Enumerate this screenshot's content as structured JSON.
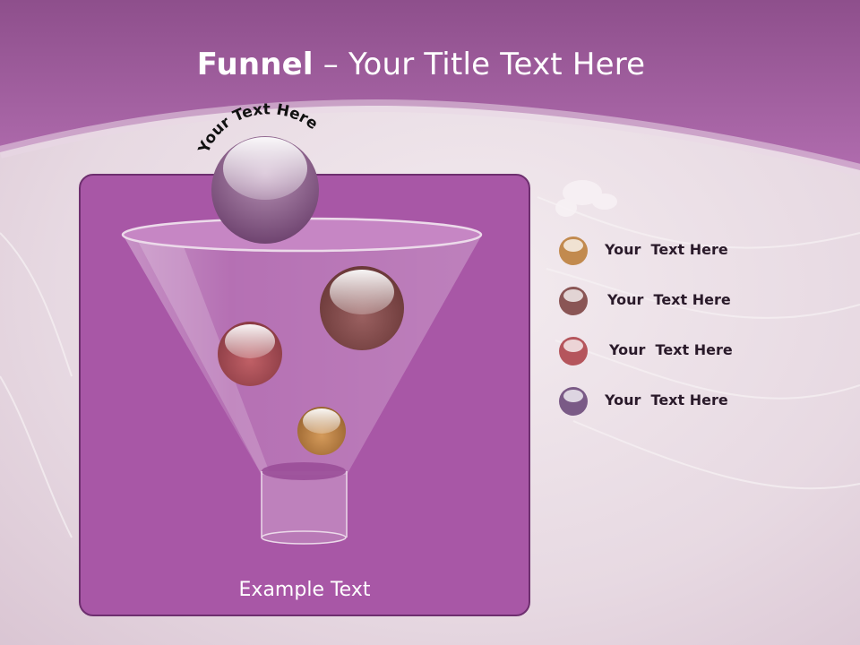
{
  "slide": {
    "title_bold": "Funnel",
    "title_rest": " – Your Title Text Here",
    "arc_label": "Your Text Here",
    "example_text": "Example Text"
  },
  "legend": {
    "items": [
      {
        "label": "Your  Text Here",
        "color": "#c28a4e"
      },
      {
        "label": "Your  Text Here",
        "color": "#8a5555"
      },
      {
        "label": "Your  Text Here",
        "color": "#b5555c"
      },
      {
        "label": "Your  Text Here",
        "color": "#7a5a86"
      }
    ]
  },
  "colors": {
    "header": "#a05a9f",
    "panel": "#a857a6",
    "panel_border": "#6e2f6f"
  }
}
